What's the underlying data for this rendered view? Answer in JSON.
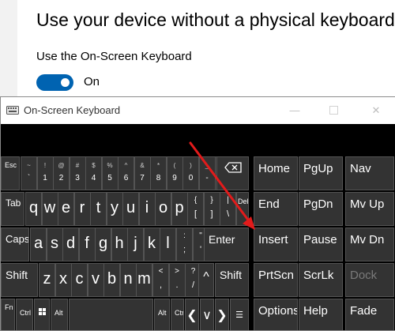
{
  "settings": {
    "heading": "Use your device without a physical keyboard",
    "osk_label": "Use the On-Screen Keyboard",
    "toggle_state": "On",
    "toggle_color": "#0063b1"
  },
  "osk": {
    "title": "On-Screen Keyboard",
    "row1": {
      "esc": "Esc",
      "pairs": [
        {
          "top": "~",
          "bot": "`"
        },
        {
          "top": "!",
          "bot": "1"
        },
        {
          "top": "@",
          "bot": "2"
        },
        {
          "top": "#",
          "bot": "3"
        },
        {
          "top": "$",
          "bot": "4"
        },
        {
          "top": "%",
          "bot": "5"
        },
        {
          "top": "^",
          "bot": "6"
        },
        {
          "top": "&",
          "bot": "7"
        },
        {
          "top": "*",
          "bot": "8"
        },
        {
          "top": "(",
          "bot": "9"
        },
        {
          "top": ")",
          "bot": "0"
        },
        {
          "top": "_",
          "bot": "-"
        },
        {
          "top": "+",
          "bot": "="
        }
      ],
      "nav": [
        "Home",
        "PgUp",
        "Nav"
      ]
    },
    "row2": {
      "tab": "Tab",
      "letters": [
        "q",
        "w",
        "e",
        "r",
        "t",
        "y",
        "u",
        "i",
        "o",
        "p"
      ],
      "pairs": [
        {
          "top": "{",
          "bot": "["
        },
        {
          "top": "}",
          "bot": "]"
        },
        {
          "top": "|",
          "bot": "\\"
        }
      ],
      "del": "Del",
      "nav": [
        "End",
        "PgDn",
        "Mv Up"
      ]
    },
    "row3": {
      "caps": "Caps",
      "letters": [
        "a",
        "s",
        "d",
        "f",
        "g",
        "h",
        "j",
        "k",
        "l"
      ],
      "pairs": [
        {
          "top": ":",
          "bot": ";"
        },
        {
          "top": "\"",
          "bot": "'"
        }
      ],
      "enter": "Enter",
      "nav": [
        "Insert",
        "Pause",
        "Mv Dn"
      ]
    },
    "row4": {
      "shift_left": "Shift",
      "letters": [
        "z",
        "x",
        "c",
        "v",
        "b",
        "n",
        "m"
      ],
      "pairs": [
        {
          "top": "<",
          "bot": ","
        },
        {
          "top": ">",
          "bot": "."
        },
        {
          "top": "?",
          "bot": "/"
        }
      ],
      "shift_right": "Shift",
      "nav": [
        "PrtScn",
        "ScrLk",
        "Dock"
      ]
    },
    "row5": {
      "fn": "Fn",
      "ctrl": "Ctrl",
      "alt": "Alt",
      "alt_right": "Alt",
      "ctrl_right": "Ctrl",
      "nav": [
        "Options",
        "Help",
        "Fade"
      ]
    }
  }
}
